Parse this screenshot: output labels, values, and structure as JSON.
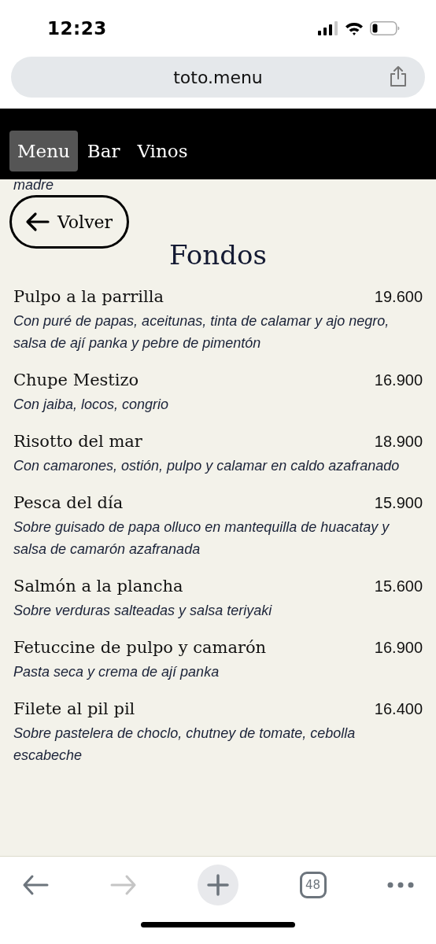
{
  "status_bar": {
    "time": "12:23"
  },
  "address_bar": {
    "url": "toto.menu"
  },
  "nav_tabs": [
    {
      "label": "Menu",
      "selected": true
    },
    {
      "label": "Bar",
      "selected": false
    },
    {
      "label": "Vinos",
      "selected": false
    }
  ],
  "cut_text": "madre",
  "back_button": {
    "label": "Volver"
  },
  "section_title": "Fondos",
  "dishes": [
    {
      "name": "Pulpo a la parrilla",
      "price": "19.600",
      "description": "Con puré de papas, aceitunas, tinta de calamar y ajo negro, salsa de ají panka y pebre de pimentón"
    },
    {
      "name": "Chupe Mestizo",
      "price": "16.900",
      "description": "Con jaiba, locos, congrio"
    },
    {
      "name": "Risotto del mar",
      "price": "18.900",
      "description": "Con camarones, ostión, pulpo y calamar en caldo azafranado"
    },
    {
      "name": "Pesca del día",
      "price": "15.900",
      "description": "Sobre guisado de papa olluco en mantequilla de huacatay y salsa de camarón azafranada"
    },
    {
      "name": "Salmón a la plancha",
      "price": "15.600",
      "description": "Sobre verduras salteadas y salsa teriyaki"
    },
    {
      "name": "Fetuccine de pulpo y camarón",
      "price": "16.900",
      "description": "Pasta seca y crema de ají panka"
    },
    {
      "name": "Filete al pil pil",
      "price": "16.400",
      "description": "Sobre pastelera de choclo, chutney de tomate, cebolla escabeche"
    }
  ],
  "browser_toolbar": [
    {
      "kind": "back",
      "disabled": false
    },
    {
      "kind": "forward",
      "disabled": true
    },
    {
      "kind": "new-tab",
      "disabled": false
    },
    {
      "kind": "tabs",
      "label": "48",
      "disabled": false
    },
    {
      "kind": "more",
      "disabled": false
    }
  ]
}
